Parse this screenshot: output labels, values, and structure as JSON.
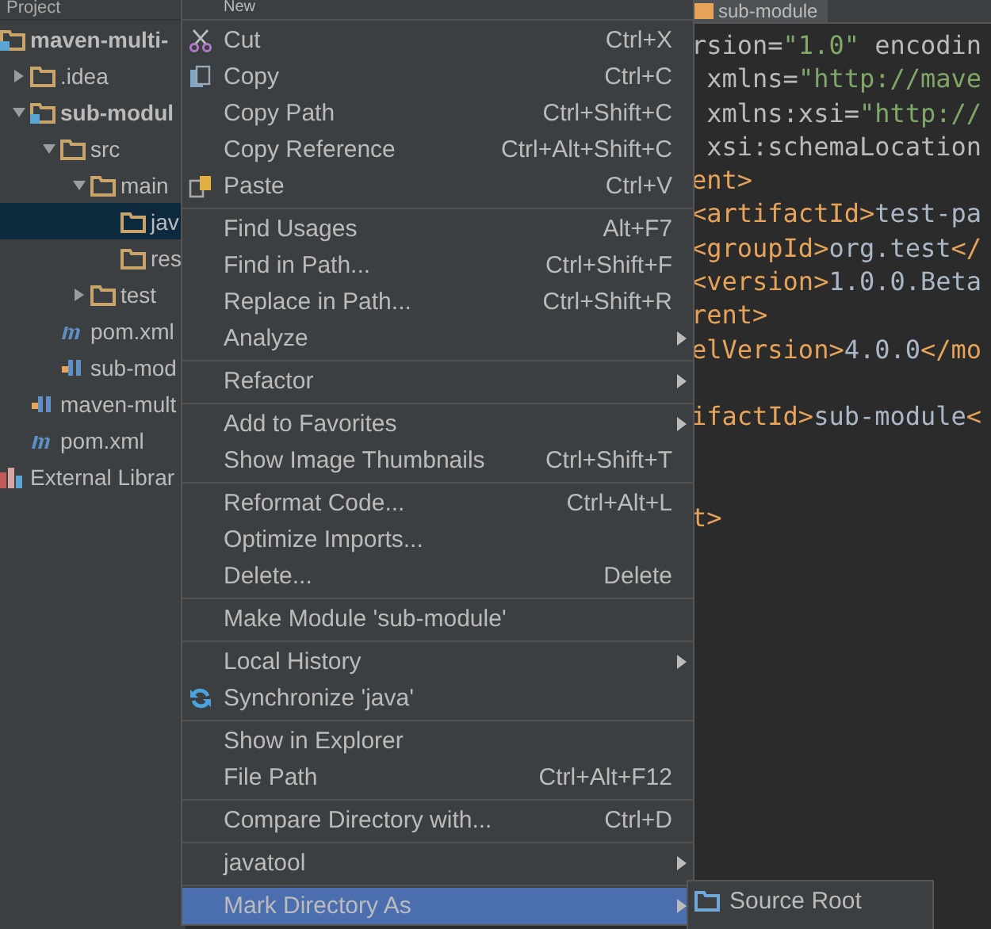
{
  "project_panel": {
    "title": "Project",
    "tree": [
      {
        "label": "maven-multi-",
        "kind": "module",
        "children": [
          {
            "label": ".idea",
            "kind": "folder",
            "expanded": false,
            "selected": false
          },
          {
            "label": "sub-modul",
            "kind": "module",
            "expanded": true,
            "selected": false,
            "children": [
              {
                "label": "src",
                "kind": "folder",
                "expanded": true,
                "selected": false,
                "children": [
                  {
                    "label": "main",
                    "kind": "folder",
                    "expanded": true,
                    "selected": false,
                    "children": [
                      {
                        "label": "jav",
                        "kind": "folder",
                        "selected": true
                      },
                      {
                        "label": "res",
                        "kind": "folder",
                        "selected": false
                      }
                    ]
                  },
                  {
                    "label": "test",
                    "kind": "folder",
                    "expanded": false,
                    "selected": false
                  }
                ]
              },
              {
                "label": "pom.xml",
                "kind": "maven",
                "selected": false
              },
              {
                "label": "sub-mod",
                "kind": "iml",
                "selected": false
              }
            ]
          },
          {
            "label": "maven-mult",
            "kind": "iml",
            "selected": false
          },
          {
            "label": "pom.xml",
            "kind": "maven",
            "selected": false
          }
        ],
        "selected": false
      },
      {
        "label": "External Librar",
        "kind": "library",
        "selected": false
      }
    ]
  },
  "editor": {
    "tab": "sub-module",
    "code_lines": [
      {
        "kind": "code",
        "segments": [
          {
            "kind": "attr",
            "text": "rsion="
          },
          {
            "kind": "string",
            "text": "\"1.0\""
          },
          {
            "kind": "attr",
            "text": " encodin"
          }
        ]
      },
      {
        "kind": "code",
        "segments": [
          {
            "kind": "attr",
            "text": " xmlns="
          },
          {
            "kind": "string",
            "text": "\"http://mave"
          }
        ]
      },
      {
        "kind": "code",
        "segments": [
          {
            "kind": "attr",
            "text": " xmlns:xsi="
          },
          {
            "kind": "string",
            "text": "\"http://"
          }
        ]
      },
      {
        "kind": "code",
        "segments": [
          {
            "kind": "attr",
            "text": " xsi:schemaLocation"
          }
        ]
      },
      {
        "kind": "code",
        "segments": [
          {
            "kind": "tag",
            "text": "ent>"
          }
        ]
      },
      {
        "kind": "code",
        "segments": [
          {
            "kind": "tag",
            "text": "<artifactId>"
          },
          {
            "kind": "text",
            "text": "test-pa"
          }
        ]
      },
      {
        "kind": "code",
        "segments": [
          {
            "kind": "tag",
            "text": "<groupId>"
          },
          {
            "kind": "text",
            "text": "org.test"
          },
          {
            "kind": "tag",
            "text": "</"
          }
        ]
      },
      {
        "kind": "code",
        "segments": [
          {
            "kind": "tag",
            "text": "<version>"
          },
          {
            "kind": "text",
            "text": "1.0.0.Beta"
          }
        ]
      },
      {
        "kind": "code",
        "segments": [
          {
            "kind": "tag",
            "text": "rent>"
          }
        ]
      },
      {
        "kind": "code",
        "segments": [
          {
            "kind": "tag",
            "text": "elVersion>"
          },
          {
            "kind": "text",
            "text": "4.0.0"
          },
          {
            "kind": "tag",
            "text": "</mo"
          }
        ]
      },
      {
        "kind": "blank"
      },
      {
        "kind": "code",
        "segments": [
          {
            "kind": "tag",
            "text": "ifactId>"
          },
          {
            "kind": "text",
            "text": "sub-module"
          },
          {
            "kind": "tag",
            "text": "<"
          }
        ]
      },
      {
        "kind": "blank"
      },
      {
        "kind": "blank"
      },
      {
        "kind": "code",
        "segments": [
          {
            "kind": "tag",
            "text": "t>"
          }
        ]
      }
    ]
  },
  "context_menu": {
    "groups": [
      [
        {
          "label": "New",
          "kind": "top",
          "submenu": false,
          "selected": false
        }
      ],
      [
        {
          "label": "Cut",
          "kind": "cut",
          "shortcut": "Ctrl+X",
          "submenu": false,
          "selected": false
        },
        {
          "label": "Copy",
          "kind": "copy",
          "shortcut": "Ctrl+C",
          "submenu": false,
          "selected": false
        },
        {
          "label": "Copy Path",
          "kind": "plain",
          "shortcut": "Ctrl+Shift+C",
          "submenu": false,
          "selected": false
        },
        {
          "label": "Copy Reference",
          "kind": "plain",
          "shortcut": "Ctrl+Alt+Shift+C",
          "submenu": false,
          "selected": false
        },
        {
          "label": "Paste",
          "kind": "paste",
          "shortcut": "Ctrl+V",
          "submenu": false,
          "selected": false
        }
      ],
      [
        {
          "label": "Find Usages",
          "kind": "plain",
          "shortcut": "Alt+F7",
          "submenu": false,
          "selected": false
        },
        {
          "label": "Find in Path...",
          "kind": "plain",
          "shortcut": "Ctrl+Shift+F",
          "submenu": false,
          "selected": false
        },
        {
          "label": "Replace in Path...",
          "kind": "plain",
          "shortcut": "Ctrl+Shift+R",
          "submenu": false,
          "selected": false
        },
        {
          "label": "Analyze",
          "kind": "plain",
          "submenu": true,
          "selected": false
        }
      ],
      [
        {
          "label": "Refactor",
          "kind": "plain",
          "submenu": true,
          "selected": false
        }
      ],
      [
        {
          "label": "Add to Favorites",
          "kind": "plain",
          "submenu": true,
          "selected": false
        },
        {
          "label": "Show Image Thumbnails",
          "kind": "plain",
          "shortcut": "Ctrl+Shift+T",
          "submenu": false,
          "selected": false
        }
      ],
      [
        {
          "label": "Reformat Code...",
          "kind": "plain",
          "shortcut": "Ctrl+Alt+L",
          "submenu": false,
          "selected": false
        },
        {
          "label": "Optimize Imports...",
          "kind": "plain",
          "submenu": false,
          "selected": false
        },
        {
          "label": "Delete...",
          "kind": "plain",
          "shortcut": "Delete",
          "submenu": false,
          "selected": false
        }
      ],
      [
        {
          "label": "Make Module 'sub-module'",
          "kind": "plain",
          "submenu": false,
          "selected": false
        }
      ],
      [
        {
          "label": "Local History",
          "kind": "plain",
          "submenu": true,
          "selected": false
        },
        {
          "label": "Synchronize 'java'",
          "kind": "sync",
          "submenu": false,
          "selected": false
        }
      ],
      [
        {
          "label": "Show in Explorer",
          "kind": "plain",
          "submenu": false,
          "selected": false
        },
        {
          "label": "File Path",
          "kind": "plain",
          "shortcut": "Ctrl+Alt+F12",
          "submenu": false,
          "selected": false
        }
      ],
      [
        {
          "label": "Compare Directory with...",
          "kind": "plain",
          "shortcut": "Ctrl+D",
          "submenu": false,
          "selected": false
        }
      ],
      [
        {
          "label": "javatool",
          "kind": "plain",
          "submenu": true,
          "selected": false
        }
      ],
      [
        {
          "label": "Mark Directory As",
          "kind": "plain",
          "submenu": true,
          "selected": true
        }
      ]
    ]
  },
  "submenu": {
    "items": [
      {
        "label": "Source Root",
        "selected": false
      }
    ]
  }
}
